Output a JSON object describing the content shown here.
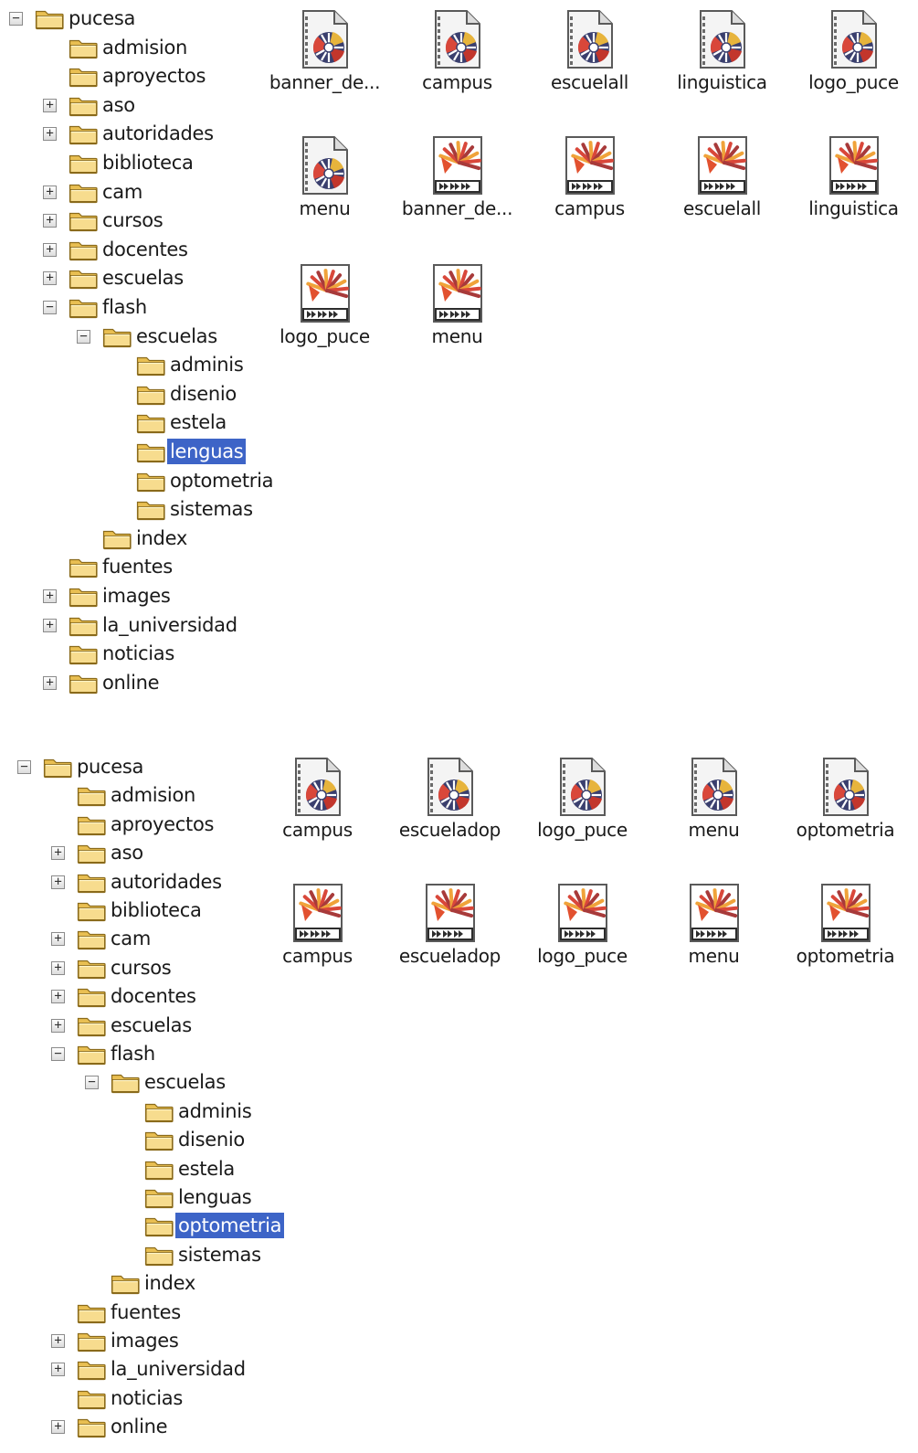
{
  "panels": [
    {
      "tree": [
        {
          "label": "pucesa",
          "level": 0,
          "toggle": "minus"
        },
        {
          "label": "admision",
          "level": 1,
          "toggle": "none"
        },
        {
          "label": "aproyectos",
          "level": 1,
          "toggle": "none"
        },
        {
          "label": "aso",
          "level": 1,
          "toggle": "plus"
        },
        {
          "label": "autoridades",
          "level": 1,
          "toggle": "plus"
        },
        {
          "label": "biblioteca",
          "level": 1,
          "toggle": "none"
        },
        {
          "label": "cam",
          "level": 1,
          "toggle": "plus"
        },
        {
          "label": "cursos",
          "level": 1,
          "toggle": "plus"
        },
        {
          "label": "docentes",
          "level": 1,
          "toggle": "plus"
        },
        {
          "label": "escuelas",
          "level": 1,
          "toggle": "plus"
        },
        {
          "label": "flash",
          "level": 1,
          "toggle": "minus"
        },
        {
          "label": "escuelas",
          "level": 2,
          "toggle": "minus"
        },
        {
          "label": "adminis",
          "level": 3,
          "toggle": "none"
        },
        {
          "label": "disenio",
          "level": 3,
          "toggle": "none"
        },
        {
          "label": "estela",
          "level": 3,
          "toggle": "none"
        },
        {
          "label": "lenguas",
          "level": 3,
          "toggle": "none",
          "selected": true
        },
        {
          "label": "optometria",
          "level": 3,
          "toggle": "none"
        },
        {
          "label": "sistemas",
          "level": 3,
          "toggle": "none"
        },
        {
          "label": "index",
          "level": 2,
          "toggle": "none"
        },
        {
          "label": "fuentes",
          "level": 1,
          "toggle": "none"
        },
        {
          "label": "images",
          "level": 1,
          "toggle": "plus"
        },
        {
          "label": "la_universidad",
          "level": 1,
          "toggle": "plus"
        },
        {
          "label": "noticias",
          "level": 1,
          "toggle": "none"
        },
        {
          "label": "online",
          "level": 1,
          "toggle": "plus"
        }
      ],
      "files": [
        {
          "name": "banner_de...",
          "icon": "flash-movie-file-icon"
        },
        {
          "name": "campus",
          "icon": "flash-movie-file-icon"
        },
        {
          "name": "escuelall",
          "icon": "flash-movie-file-icon"
        },
        {
          "name": "linguistica",
          "icon": "flash-movie-file-icon"
        },
        {
          "name": "logo_puce",
          "icon": "flash-movie-file-icon"
        },
        {
          "name": "menu",
          "icon": "flash-movie-file-icon"
        },
        {
          "name": "banner_de...",
          "icon": "flash-document-file-icon"
        },
        {
          "name": "campus",
          "icon": "flash-document-file-icon"
        },
        {
          "name": "escuelall",
          "icon": "flash-document-file-icon"
        },
        {
          "name": "linguistica",
          "icon": "flash-document-file-icon"
        },
        {
          "name": "logo_puce",
          "icon": "flash-document-file-icon"
        },
        {
          "name": "menu",
          "icon": "flash-document-file-icon"
        }
      ]
    },
    {
      "tree": [
        {
          "label": "pucesa",
          "level": 0,
          "toggle": "minus"
        },
        {
          "label": "admision",
          "level": 1,
          "toggle": "none"
        },
        {
          "label": "aproyectos",
          "level": 1,
          "toggle": "none"
        },
        {
          "label": "aso",
          "level": 1,
          "toggle": "plus"
        },
        {
          "label": "autoridades",
          "level": 1,
          "toggle": "plus"
        },
        {
          "label": "biblioteca",
          "level": 1,
          "toggle": "none"
        },
        {
          "label": "cam",
          "level": 1,
          "toggle": "plus"
        },
        {
          "label": "cursos",
          "level": 1,
          "toggle": "plus"
        },
        {
          "label": "docentes",
          "level": 1,
          "toggle": "plus"
        },
        {
          "label": "escuelas",
          "level": 1,
          "toggle": "plus"
        },
        {
          "label": "flash",
          "level": 1,
          "toggle": "minus"
        },
        {
          "label": "escuelas",
          "level": 2,
          "toggle": "minus"
        },
        {
          "label": "adminis",
          "level": 3,
          "toggle": "none"
        },
        {
          "label": "disenio",
          "level": 3,
          "toggle": "none"
        },
        {
          "label": "estela",
          "level": 3,
          "toggle": "none"
        },
        {
          "label": "lenguas",
          "level": 3,
          "toggle": "none"
        },
        {
          "label": "optometria",
          "level": 3,
          "toggle": "none",
          "selected": true
        },
        {
          "label": "sistemas",
          "level": 3,
          "toggle": "none"
        },
        {
          "label": "index",
          "level": 2,
          "toggle": "none"
        },
        {
          "label": "fuentes",
          "level": 1,
          "toggle": "none"
        },
        {
          "label": "images",
          "level": 1,
          "toggle": "plus"
        },
        {
          "label": "la_universidad",
          "level": 1,
          "toggle": "plus"
        },
        {
          "label": "noticias",
          "level": 1,
          "toggle": "none"
        },
        {
          "label": "online",
          "level": 1,
          "toggle": "plus"
        }
      ],
      "files": [
        {
          "name": "campus",
          "icon": "flash-movie-file-icon"
        },
        {
          "name": "escueladop",
          "icon": "flash-movie-file-icon"
        },
        {
          "name": "logo_puce",
          "icon": "flash-movie-file-icon"
        },
        {
          "name": "menu",
          "icon": "flash-movie-file-icon"
        },
        {
          "name": "optometria",
          "icon": "flash-movie-file-icon"
        },
        {
          "name": "campus",
          "icon": "flash-document-file-icon"
        },
        {
          "name": "escueladop",
          "icon": "flash-document-file-icon"
        },
        {
          "name": "logo_puce",
          "icon": "flash-document-file-icon"
        },
        {
          "name": "menu",
          "icon": "flash-document-file-icon"
        },
        {
          "name": "optometria",
          "icon": "flash-document-file-icon"
        }
      ]
    }
  ],
  "colors": {
    "selection": "#3d64c7",
    "folder": "#f3d27a"
  }
}
